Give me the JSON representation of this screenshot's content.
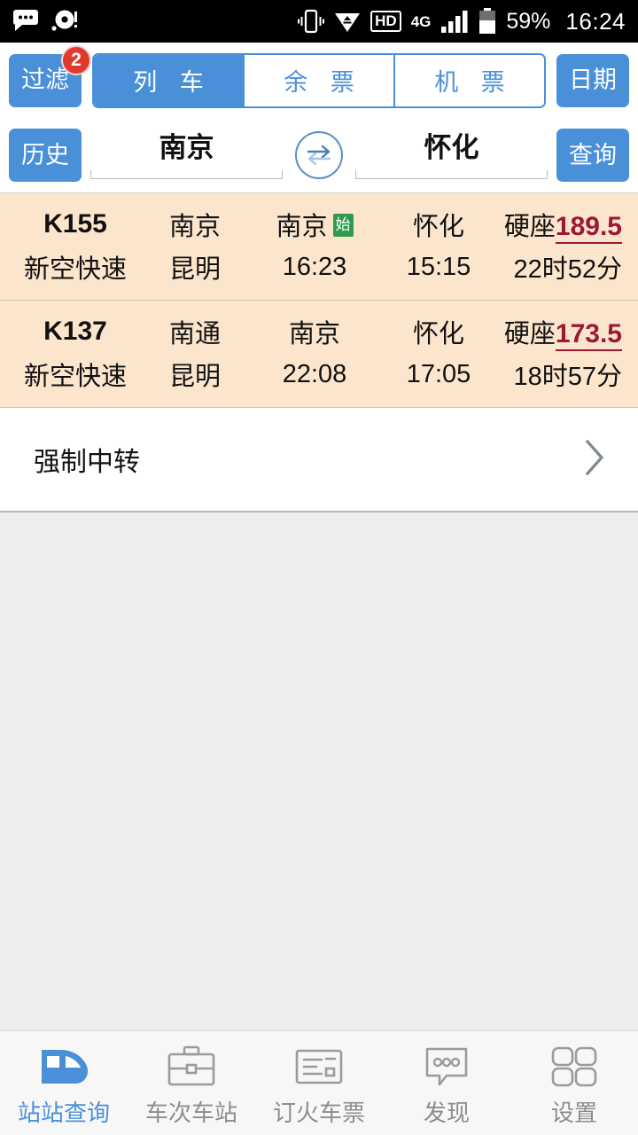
{
  "statusbar": {
    "icons": [
      "message-bubble-icon",
      "disc-alert-icon",
      "vibrate-icon",
      "wifi-triangle-icon"
    ],
    "hd_label": "HD",
    "network_label": "4G",
    "battery_pct": "59%",
    "time": "16:24"
  },
  "toolbar": {
    "filter_label": "过滤",
    "filter_badge": "2",
    "tabs": [
      {
        "label": "列 车",
        "active": true
      },
      {
        "label": "余 票",
        "active": false
      },
      {
        "label": "机 票",
        "active": false
      }
    ],
    "date_label": "日期",
    "history_label": "历史",
    "query_label": "查询",
    "from_station": "南京",
    "to_station": "怀化",
    "swap_icon": "swap-arrows-icon"
  },
  "colors": {
    "accent_blue": "#4a90d9",
    "badge_red": "#e03a2f",
    "row_bg": "#fce5cd",
    "price_red": "#9c1834",
    "start_green": "#2e9b4f",
    "nav_inactive": "#8d8d8d"
  },
  "trains": [
    {
      "code": "K155",
      "type": "新空快速",
      "from_station": "南京",
      "to_station": "昆明",
      "board_station": "南京",
      "board_badge": "始",
      "depart_time": "16:23",
      "alight_station": "怀化",
      "arrive_time": "15:15",
      "seat_label": "硬座",
      "price": "189.5",
      "duration": "22时52分"
    },
    {
      "code": "K137",
      "type": "新空快速",
      "from_station": "南通",
      "to_station": "昆明",
      "board_station": "南京",
      "board_badge": "",
      "depart_time": "22:08",
      "alight_station": "怀化",
      "arrive_time": "17:05",
      "seat_label": "硬座",
      "price": "173.5",
      "duration": "18时57分"
    }
  ],
  "transfer": {
    "label": "强制中转",
    "chevron_icon": "chevron-right-icon"
  },
  "bottomnav": [
    {
      "label": "站站查询",
      "icon": "train-front-icon",
      "active": true
    },
    {
      "label": "车次车站",
      "icon": "briefcase-icon",
      "active": false
    },
    {
      "label": "订火车票",
      "icon": "ticket-icon",
      "active": false
    },
    {
      "label": "发现",
      "icon": "chat-dots-icon",
      "active": false
    },
    {
      "label": "设置",
      "icon": "grid-squares-icon",
      "active": false
    }
  ]
}
